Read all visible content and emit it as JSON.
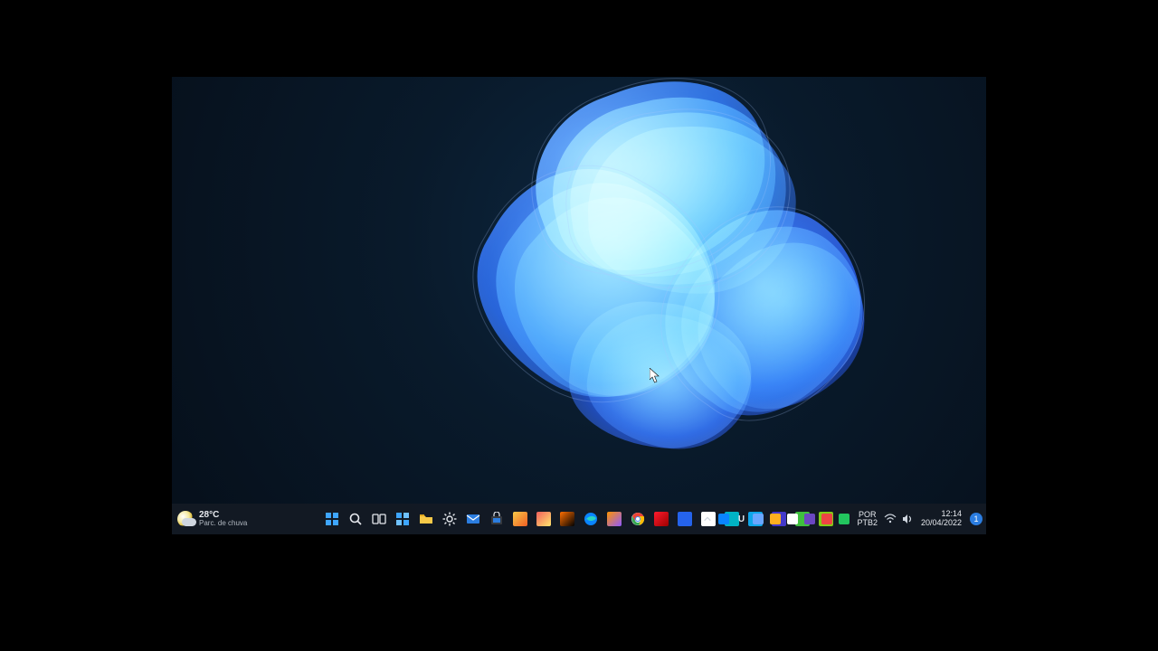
{
  "weather": {
    "temperature": "28°C",
    "condition": "Parc. de chuva"
  },
  "taskbar": {
    "items": [
      {
        "name": "start-button",
        "kind": "start"
      },
      {
        "name": "search-button",
        "kind": "search"
      },
      {
        "name": "task-view-button",
        "kind": "taskview"
      },
      {
        "name": "widgets-button",
        "kind": "widgets"
      },
      {
        "name": "file-explorer-app",
        "kind": "explorer"
      },
      {
        "name": "settings-app",
        "kind": "gear"
      },
      {
        "name": "mail-app",
        "kind": "mail"
      },
      {
        "name": "store-app",
        "kind": "store"
      },
      {
        "name": "music-app",
        "kind": "color",
        "color1": "#f7c948",
        "color2": "#f05e23"
      },
      {
        "name": "photos-app",
        "kind": "color",
        "color1": "#f25f5c",
        "color2": "#ffe66d"
      },
      {
        "name": "media-app",
        "kind": "color",
        "color1": "#ff6f00",
        "color2": "#000000"
      },
      {
        "name": "edge-browser",
        "kind": "edge"
      },
      {
        "name": "firefox-browser",
        "kind": "color",
        "color1": "#ff9400",
        "color2": "#9059ff"
      },
      {
        "name": "chrome-browser",
        "kind": "chrome"
      },
      {
        "name": "opera-browser",
        "kind": "color",
        "color1": "#ff1b2d",
        "color2": "#9c0000"
      },
      {
        "name": "app-blue",
        "kind": "solid",
        "color": "#2563eb"
      },
      {
        "name": "app-white",
        "kind": "solid",
        "color": "#ffffff"
      },
      {
        "name": "app-teal",
        "kind": "solid",
        "color": "#00b3c4"
      },
      {
        "name": "app-cyan",
        "kind": "solid",
        "color": "#0ea5e9"
      },
      {
        "name": "app-indigo",
        "kind": "solid",
        "color": "#4338ca"
      },
      {
        "name": "app-green",
        "kind": "solid",
        "color": "#3fbf3f"
      },
      {
        "name": "app-green2",
        "kind": "solid",
        "color": "#84cc16"
      }
    ]
  },
  "tray": {
    "chevron": "chevron-up-icon",
    "icons": [
      {
        "name": "tray-onedrive",
        "color": "#0a84ff"
      },
      {
        "name": "tray-u",
        "text": "U"
      },
      {
        "name": "tray-security",
        "color": "#6aa6ff"
      },
      {
        "name": "tray-bt",
        "color": "#ffb020"
      },
      {
        "name": "tray-net",
        "color": "#ffffff"
      },
      {
        "name": "tray-app1",
        "color": "#6b46c1"
      },
      {
        "name": "tray-app2",
        "color": "#ef4444"
      },
      {
        "name": "tray-app3",
        "color": "#22c55e"
      }
    ],
    "lang_top": "POR",
    "lang_bottom": "PTB2",
    "wifi": "wifi-icon",
    "volume": "volume-icon",
    "clock_time": "12:14",
    "clock_date": "20/04/2022",
    "notif_count": "1"
  }
}
